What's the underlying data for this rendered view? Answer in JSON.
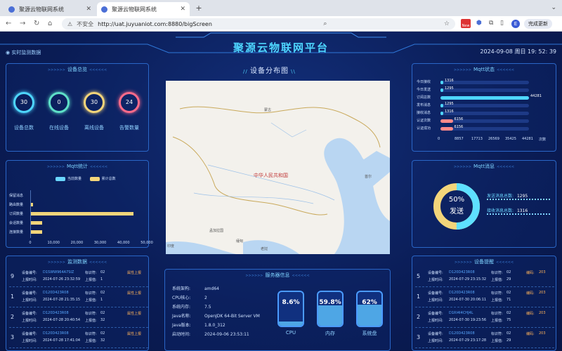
{
  "browser": {
    "tabs": [
      {
        "label": "聚源云物联网系统",
        "active": false
      },
      {
        "label": "聚源云物联网系统",
        "active": true
      }
    ],
    "security_label": "不安全",
    "url": "http://uat.juyuaniot.com:8880/bigScreen",
    "new_badge": "New",
    "avatar_letter": "E",
    "update_label": "完成更新"
  },
  "dashboard": {
    "title": "聚源云物联网平台",
    "realtime_label": "实时监测数据",
    "datetime": "2024-09-08 周日 19: 52: 39",
    "device_overview": {
      "title": "设备总览",
      "items": [
        {
          "label": "设备总数",
          "value": "30",
          "color": "#4ed6ff"
        },
        {
          "label": "在线设备",
          "value": "0",
          "color": "#5ee0c8"
        },
        {
          "label": "离线设备",
          "value": "30",
          "color": "#f3d57a"
        },
        {
          "label": "告警数量",
          "value": "24",
          "color": "#ff6b8a"
        }
      ]
    },
    "mqtt_stats": {
      "title": "Mqtt统计",
      "legend": [
        {
          "label": "当前数量",
          "color": "#6ad6ff"
        },
        {
          "label": "累计总数",
          "color": "#f3d57a"
        }
      ],
      "categories": [
        "保留消息",
        "路由数量",
        "订阅数量",
        "会话数量",
        "连接数量"
      ],
      "values": [
        0,
        1200,
        44281,
        5000,
        5000
      ],
      "x_ticks": [
        "0",
        "10,000",
        "20,000",
        "30,000",
        "40,000",
        "50,000"
      ],
      "xmax": 50000
    },
    "mqtt_status": {
      "title": "Mqtt状态",
      "rows": [
        {
          "label": "今日接收",
          "value": "1316",
          "num": 1316,
          "color": "#4ed6ff"
        },
        {
          "label": "今日发送",
          "value": "1295",
          "num": 1295,
          "color": "#4ed6ff"
        },
        {
          "label": "订阅总数",
          "value": "44281",
          "num": 44281,
          "color": "#4ed6ff"
        },
        {
          "label": "发布消息",
          "value": "1295",
          "num": 1295,
          "color": "#4ed6ff"
        },
        {
          "label": "接收消息",
          "value": "1316",
          "num": 1316,
          "color": "#4ed6ff"
        },
        {
          "label": "认证次数",
          "value": "6156",
          "num": 6156,
          "color": "#ff8a8a"
        },
        {
          "label": "认证成功",
          "value": "6156",
          "num": 6156,
          "color": "#ff8a8a"
        }
      ],
      "x_ticks": [
        "0",
        "8857",
        "17713",
        "26569",
        "35425",
        "44281",
        "次数"
      ],
      "xmax": 44281
    },
    "device_map": {
      "title": "设备分布图",
      "labels": [
        {
          "text": "中华人民共和国"
        },
        {
          "text": "蒙古"
        },
        {
          "text": "首尔"
        },
        {
          "text": "孟加拉国"
        },
        {
          "text": "缅甸"
        },
        {
          "text": "老挝"
        },
        {
          "text": "印度"
        }
      ]
    },
    "mqtt_message": {
      "title": "Mqtt消息",
      "percent": 50,
      "center_pct": "50%",
      "center_label": "发送",
      "send_label": "发送消息总数:",
      "send_value": "1295",
      "recv_label": "接收消息总数:",
      "recv_value": "1316"
    },
    "monitor": {
      "title": "监测数据",
      "rows": [
        {
          "idx": "9",
          "code_label": "设备编号:",
          "code": "D1SWW964A7SIZ",
          "id_label": "标识符:",
          "id": "02",
          "type": "属性上报",
          "time_label": "上报时间:",
          "time": "2024-07-26 23:32:59",
          "val_label": "上报值:",
          "val": "1"
        },
        {
          "idx": "1",
          "code_label": "设备编号:",
          "code": "D120D423R08",
          "id_label": "标识符:",
          "id": "02",
          "type": "属性上报",
          "time_label": "上报时间:",
          "time": "2024-07-28 21:35:15",
          "val_label": "上报值:",
          "val": "1"
        },
        {
          "idx": "2",
          "code_label": "设备编号:",
          "code": "D120D423R08",
          "id_label": "标识符:",
          "id": "02",
          "type": "属性上报",
          "time_label": "上报时间:",
          "time": "2024-07-28 20:40:54",
          "val_label": "上报值:",
          "val": "32"
        },
        {
          "idx": "3",
          "code_label": "设备编号:",
          "code": "D120D423R08",
          "id_label": "标识符:",
          "id": "02",
          "type": "属性上报",
          "time_label": "上报时间:",
          "time": "2024-07-28 17:41:04",
          "val_label": "上报值:",
          "val": "32"
        }
      ]
    },
    "server_info": {
      "title": "服务器信息",
      "rows": [
        {
          "k": "系统架构:",
          "v": "amd64"
        },
        {
          "k": "CPU核心:",
          "v": "2"
        },
        {
          "k": "系统内存:",
          "v": "7.5"
        },
        {
          "k": "Java名称:",
          "v": "OpenJDK 64-Bit Server VM"
        },
        {
          "k": "Java版本:",
          "v": "1.8.0_312"
        },
        {
          "k": "启动时间:",
          "v": "2024-09-06 23:53:11"
        }
      ],
      "gauges": [
        {
          "label": "CPU",
          "pct": "8.6%",
          "num": 8.6
        },
        {
          "label": "内存",
          "pct": "59.8%",
          "num": 59.8
        },
        {
          "label": "系统盘",
          "pct": "62%",
          "num": 62
        }
      ]
    },
    "alarm": {
      "title": "设备提醒",
      "rows": [
        {
          "idx": "5",
          "code_label": "设备编号:",
          "code": "D120D423R08",
          "id_label": "标识符:",
          "id": "02",
          "level_label": "编码:",
          "level": "203",
          "time_label": "上报时间:",
          "time": "2024-07-29 23:15:32",
          "val_label": "上报值:",
          "val": "29"
        },
        {
          "idx": "1",
          "code_label": "设备编号:",
          "code": "D120D423R08",
          "id_label": "标识符:",
          "id": "02",
          "level_label": "编码:",
          "level": "203",
          "time_label": "上报时间:",
          "time": "2024-07-30 20:06:11",
          "val_label": "上报值:",
          "val": "71"
        },
        {
          "idx": "2",
          "code_label": "设备编号:",
          "code": "D1RI4I4CHJ4L",
          "id_label": "标识符:",
          "id": "02",
          "level_label": "编码:",
          "level": "203",
          "time_label": "上报时间:",
          "time": "2024-07-30 19:23:56",
          "val_label": "上报值:",
          "val": "75"
        },
        {
          "idx": "3",
          "code_label": "设备编号:",
          "code": "D120D423R08",
          "id_label": "标识符:",
          "id": "02",
          "level_label": "编码:",
          "level": "203",
          "time_label": "上报时间:",
          "time": "2024-07-29 23:17:28",
          "val_label": "上报值:",
          "val": "29"
        }
      ]
    }
  }
}
